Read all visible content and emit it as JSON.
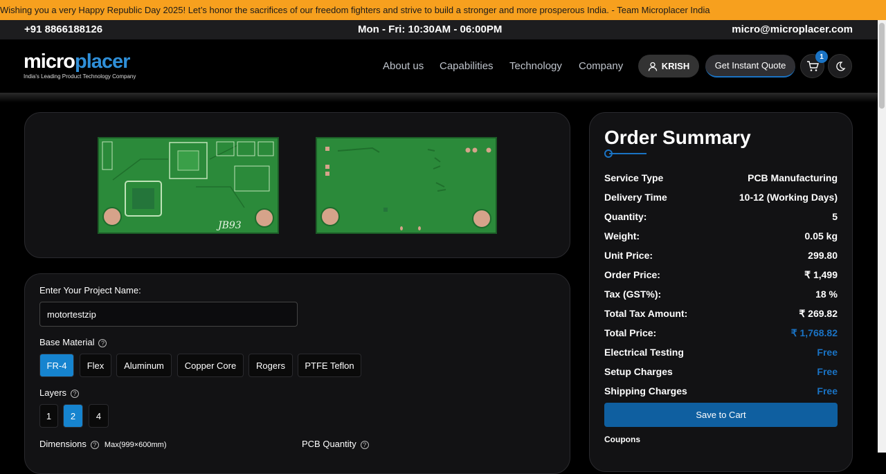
{
  "announcement": "Wishing you a very Happy Republic Day 2025! Let’s honor the sacrifices of our freedom fighters and strive to build a stronger and more prosperous India. - Team Microplacer India",
  "contact": {
    "phone": "+91 8866188126",
    "hours": "Mon - Fri: 10:30AM - 06:00PM",
    "email": "micro@microplacer.com"
  },
  "brand": {
    "logo_part1": "micro",
    "logo_part2": "placer",
    "tagline": "India's Leading Product Technology Company"
  },
  "nav": {
    "items": [
      "About us",
      "Capabilities",
      "Technology",
      "Company"
    ],
    "user_label": "KRISH",
    "quote_label": "Get Instant Quote",
    "cart_count": "1"
  },
  "pcb": {
    "front_marking": "JB93"
  },
  "form": {
    "project_label": "Enter Your Project Name:",
    "project_value": "motortestzip",
    "base_material_label": "Base Material",
    "materials": [
      "FR-4",
      "Flex",
      "Aluminum",
      "Copper Core",
      "Rogers",
      "PTFE Teflon"
    ],
    "selected_material": "FR-4",
    "layers_label": "Layers",
    "layers": [
      "1",
      "2",
      "4"
    ],
    "selected_layer": "2",
    "dimensions_label": "Dimensions",
    "dimensions_hint": "Max(999×600mm)",
    "quantity_label": "PCB Quantity",
    "help_glyph": "?"
  },
  "summary": {
    "title": "Order Summary",
    "rows": [
      {
        "label": "Service Type",
        "value": "PCB Manufacturing"
      },
      {
        "label": "Delivery Time",
        "value": "10-12 (Working Days)"
      },
      {
        "label": "Quantity:",
        "value": "5"
      },
      {
        "label": "Weight:",
        "value": "0.05 kg"
      },
      {
        "label": "Unit Price:",
        "value": "299.80"
      },
      {
        "label": "Order Price:",
        "value": "₹ 1,499"
      },
      {
        "label": "Tax (GST%):",
        "value": "18 %"
      },
      {
        "label": "Total Tax Amount:",
        "value": "₹ 269.82"
      },
      {
        "label": "Total Price:",
        "value": "₹ 1,768.82"
      },
      {
        "label": "Electrical Testing",
        "value": "Free"
      },
      {
        "label": "Setup Charges",
        "value": "Free"
      },
      {
        "label": "Shipping Charges",
        "value": "Free"
      }
    ],
    "save_label": "Save to Cart",
    "coupons_label": "Coupons"
  }
}
